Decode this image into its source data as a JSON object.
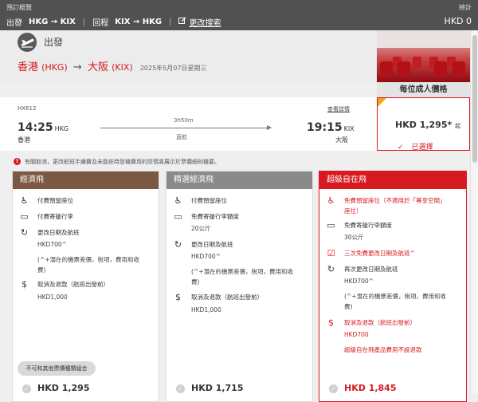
{
  "topbar": {
    "summary_label": "預訂概覽",
    "depart_label": "出發",
    "depart_route": "HKG → KIX",
    "return_label": "回程",
    "return_route": "KIX → HKG",
    "edit_label": "更改搜索",
    "total_label": "總計",
    "total_value": "HKD 0"
  },
  "departure": {
    "label": "出發",
    "origin_city": "香港",
    "origin_code": "(HKG)",
    "dest_city": "大阪",
    "dest_code": "(KIX)",
    "date": "2025年5月07日星期三"
  },
  "price_header": "每位成人價格",
  "flight": {
    "number": "HX612",
    "details_link": "查看詳情",
    "depart_time": "14:25",
    "depart_code": "HKG",
    "depart_city": "香港",
    "duration": "3h50m",
    "stops": "直航",
    "arrive_time": "19:15",
    "arrive_code": "KIX",
    "arrive_city": "大阪",
    "price": "HKD 1,295*",
    "price_suffix": "起",
    "selected_label": "已選擇"
  },
  "notice": "有關取消，更改航班手續費及未能依時登機費用的詳情將展示於票價細則機要。",
  "fares": [
    {
      "name": "經濟飛",
      "features": [
        {
          "icon": "seat-icon",
          "text": "付費預留座位"
        },
        {
          "icon": "baggage-icon",
          "text": "付費寄艙行李"
        },
        {
          "icon": "change-icon",
          "text": "更改日期及航班",
          "sub": [
            "HKD700^",
            "(^+潛在的機票差價，稅項，費用和收",
            "費)"
          ]
        },
        {
          "icon": "refund-icon",
          "text": "取消及退款（航班出發前）",
          "sub": [
            "HKD1,000"
          ]
        }
      ],
      "combo_note": "不可和其他票價種類組合",
      "price": "HKD 1,295"
    },
    {
      "name": "精選經濟飛",
      "features": [
        {
          "icon": "seat-icon",
          "text": "付費預留座位"
        },
        {
          "icon": "baggage-icon",
          "text": "免費寄艙行李額度",
          "sub": [
            "20公斤"
          ]
        },
        {
          "icon": "change-icon",
          "text": "更改日期及航班",
          "sub": [
            "HKD700^",
            "(^+潛在的機票差價，稅項，費用和收",
            "費)"
          ]
        },
        {
          "icon": "refund-icon",
          "text": "取消及退款（航班出發前）",
          "sub": [
            "HKD1,000"
          ]
        }
      ],
      "price": "HKD 1,715"
    },
    {
      "name": "超級自在飛",
      "features": [
        {
          "icon": "seat-icon",
          "text": "免費預留座位（不適用於「尊享空間」",
          "text2": "座位）"
        },
        {
          "icon": "baggage-icon",
          "text": "免費寄艙行李額度",
          "sub": [
            "30公斤"
          ]
        },
        {
          "icon": "calendar-icon",
          "text": "三次免費更改日期及航班^"
        },
        {
          "icon": "change-icon",
          "text": "再次更改日期及航班",
          "sub": [
            "HKD700^",
            "(^+潛在的機票差價，稅項，費用和收",
            "費)"
          ]
        },
        {
          "icon": "refund-icon",
          "text": "取消及退款（航班出發前）",
          "sub": [
            "HKD700",
            "超級自在飛產品費用不設退款"
          ]
        }
      ],
      "price": "HKD 1,845"
    }
  ],
  "colors": {
    "brand_red": "#d71920",
    "economy": "#7b5842",
    "select_economy": "#8a8a8a",
    "badge": "#f3a20f"
  }
}
